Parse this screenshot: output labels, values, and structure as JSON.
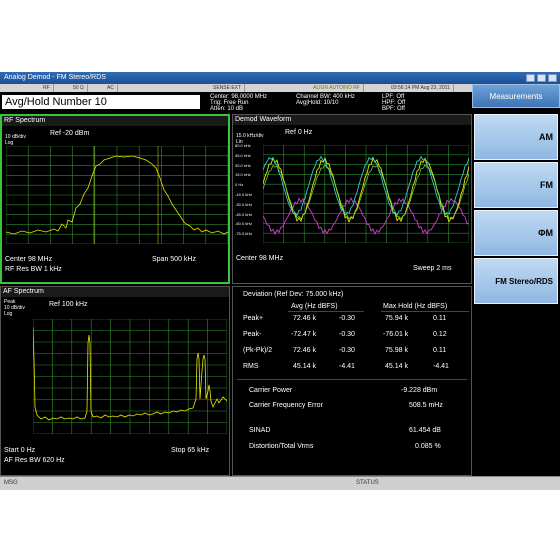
{
  "window": {
    "title": "Analog Demod - FM Stereo/RDS"
  },
  "mode_row": {
    "c1": "RF",
    "c2": "50 Ω",
    "c3": "AC",
    "c4": "SENSE:EXT",
    "c5": "ALIGN AUTO/NO RF",
    "c6": "03:56:14 PM Aug 23, 2011"
  },
  "header": {
    "meas_title": "Avg/Hold Number 10",
    "center": "Center: 98.0000 MHz",
    "trig": "Trig: Free Run",
    "atten": "Atten: 10 dB",
    "channel_bw": "Channel BW: 400 kHz",
    "avg_hold": "Avg|Hold: 10/10",
    "lpf": "LPF: Off",
    "hpf": "HPF: Off",
    "bpf": "BPF: Off"
  },
  "rf_spectrum": {
    "title": "RF Spectrum",
    "scale": "10 dB/div",
    "scale_type": "Log",
    "ref": "Ref -20 dBm",
    "center": "Center  98 MHz",
    "span": "Span 500 kHz",
    "res_bw": "RF Res BW  1 kHz"
  },
  "demod_waveform": {
    "title": "Demod Waveform",
    "scale": "15.0 kHz/div",
    "scale_type": "Lin",
    "ref": "Ref 0 Hz",
    "center": "Center  98 MHz",
    "sweep": "Sweep  2 ms",
    "y_ticks": [
      "60.0 kHz",
      "45.0 kHz",
      "30.0 kHz",
      "15.0 kHz",
      "0 Hz",
      "-15.0 kHz",
      "-30.0 kHz",
      "-45.0 kHz",
      "-60.0 kHz",
      "-75.0 kHz"
    ]
  },
  "af_spectrum": {
    "title": "AF Spectrum",
    "detector": "Peak",
    "scale": "10 dB/div",
    "scale_type": "Log",
    "ref": "Ref 100 kHz",
    "start": "Start  0 Hz",
    "stop": "Stop 65 kHz",
    "res_bw": "AF Res BW  620 Hz"
  },
  "deviation": {
    "title": "Deviation  (Ref Dev: 75.000 kHz)",
    "col_avg": "Avg (Hz  dBFS)",
    "col_max": "Max Hold (Hz  dBFS)",
    "rows": [
      {
        "label": "Peak+",
        "avg_hz": "72.46 k",
        "avg_dbfs": "-0.30",
        "max_hz": "75.94 k",
        "max_dbfs": "0.11"
      },
      {
        "label": "Peak-",
        "avg_hz": "-72.47 k",
        "avg_dbfs": "-0.30",
        "max_hz": "-76.01 k",
        "max_dbfs": "0.12"
      },
      {
        "label": "(Pk-Pk)/2",
        "avg_hz": "72.46 k",
        "avg_dbfs": "-0.30",
        "max_hz": "75.98 k",
        "max_dbfs": "0.11"
      },
      {
        "label": "RMS",
        "avg_hz": "45.14 k",
        "avg_dbfs": "-4.41",
        "max_hz": "45.14 k",
        "max_dbfs": "-4.41"
      }
    ]
  },
  "results": {
    "carrier_power_label": "Carrier Power",
    "carrier_power": "-9.228 dBm",
    "cfe_label": "Carrier Frequency Error",
    "cfe": "508.5 mHz",
    "sinad_label": "SINAD",
    "sinad": "61.454 dB",
    "dist_label": "Distortion/Total Vrms",
    "dist": "0.085 %"
  },
  "softkeys": {
    "header": "Measurements",
    "items": [
      "AM",
      "FM",
      "ΦM",
      "FM Stereo/RDS"
    ]
  },
  "status": {
    "msg": "MSG",
    "status": "STATUS"
  },
  "colors": {
    "trace_yellow": "#e8e800",
    "trace_cyan": "#33cccc",
    "trace_magenta": "#d040d0",
    "grid": "#2f8f2f",
    "active_border": "#3cc33c"
  }
}
